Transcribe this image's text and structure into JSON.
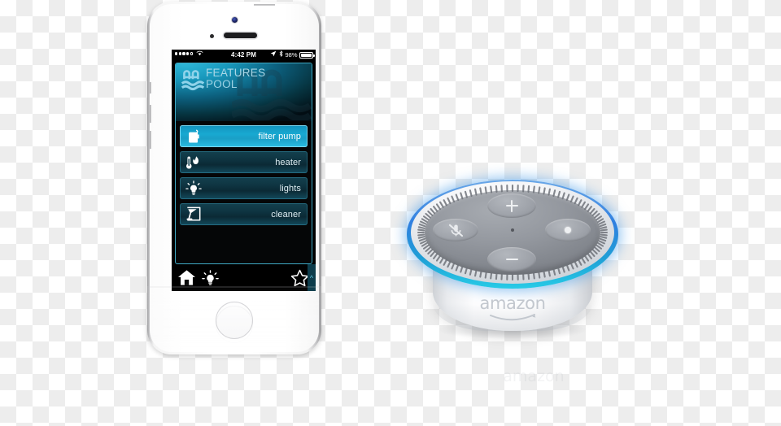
{
  "phone": {
    "status_bar": {
      "carrier_signal": "•••••",
      "wifi_icon": "wifi-icon",
      "time": "4:42 PM",
      "location_icon": "location-arrow-icon",
      "bluetooth_icon": "bluetooth-icon",
      "battery_percent": "98%"
    },
    "app": {
      "header": {
        "title": "FEATURES",
        "subtitle": "POOL",
        "logo_icon": "pool-ladder-waves-icon"
      },
      "rows": [
        {
          "label": "filter pump",
          "icon": "filter-pump-icon",
          "state": "active"
        },
        {
          "label": "heater",
          "icon": "thermometer-flame-icon",
          "state": "inactive"
        },
        {
          "label": "lights",
          "icon": "lightbulb-icon",
          "state": "inactive"
        },
        {
          "label": "cleaner",
          "icon": "pool-cleaner-icon",
          "state": "inactive"
        }
      ],
      "tabbar": {
        "home_icon": "home-icon",
        "lights_icon": "lightbulb-icon",
        "favorite_icon": "star-outline-icon",
        "expand_icon": "chevron-up-icon"
      }
    },
    "home_button": "home-button"
  },
  "echo": {
    "brand": "amazon",
    "buttons": {
      "volume_up": "plus-icon",
      "volume_down": "minus-icon",
      "microphone_off": "mic-mute-icon",
      "action": "action-button-icon"
    },
    "light_ring_color": "#2f7fe0",
    "body_color": "#ffffff"
  },
  "colors": {
    "accent_cyan": "#3fa9c4",
    "active_row": "#18a9d1",
    "inactive_row": "#0e3441",
    "ring_blue": "#2f7fe0",
    "checker_gray": "#ededed"
  }
}
